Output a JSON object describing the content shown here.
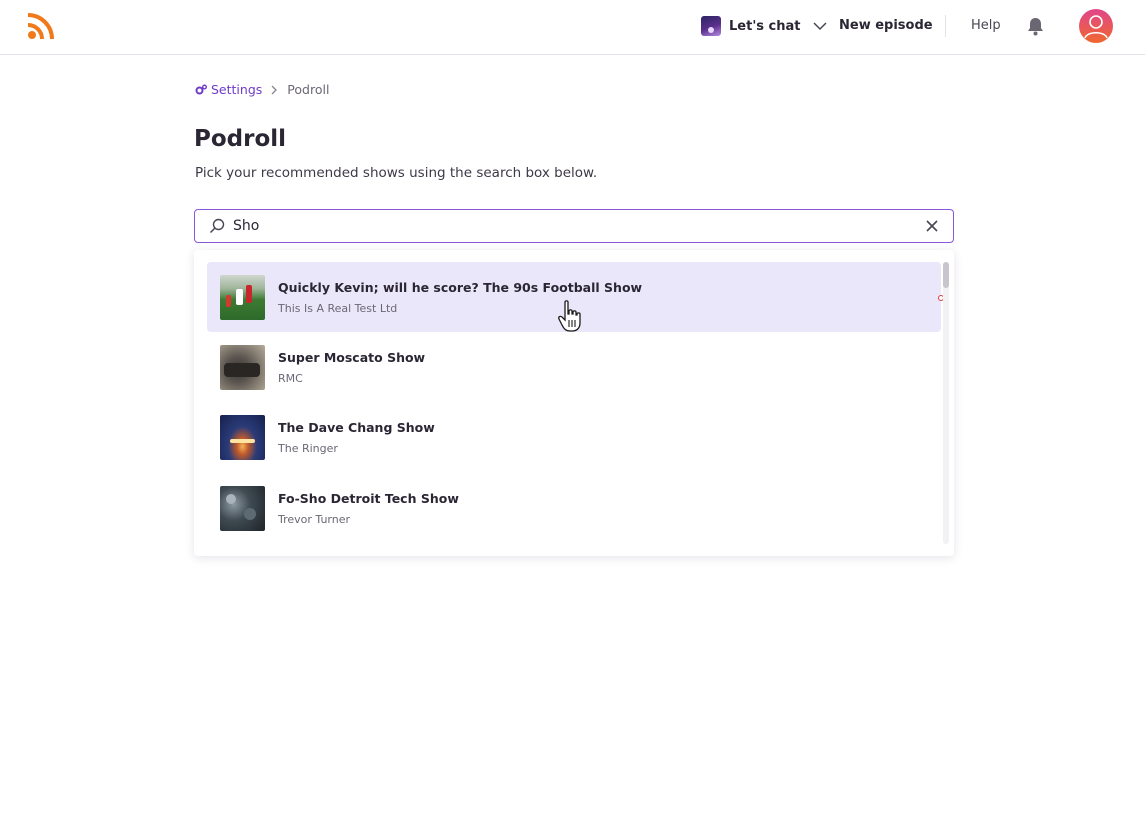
{
  "header": {
    "logo_icon": "rss-feed-icon",
    "show_name": "Let's chat",
    "new_episode_label": "New episode",
    "help_label": "Help",
    "bell_icon": "bell-icon",
    "avatar_icon": "user-avatar-icon"
  },
  "breadcrumb": {
    "settings_label": "Settings",
    "current_label": "Podroll"
  },
  "page": {
    "title": "Podroll",
    "subtitle": "Pick your recommended shows using the search box below."
  },
  "search": {
    "value": "Sho",
    "clear_icon": "close-icon"
  },
  "results": [
    {
      "title": "Quickly Kevin; will he score? The 90s Football Show",
      "author": "This Is A Real Test Ltd",
      "active": true
    },
    {
      "title": "Super Moscato Show",
      "author": "RMC",
      "active": false
    },
    {
      "title": "The Dave Chang Show",
      "author": "The Ringer",
      "active": false
    },
    {
      "title": "Fo-Sho Detroit Tech Show",
      "author": "Trevor Turner",
      "active": false
    }
  ],
  "colors": {
    "accent": "#6f3cc8",
    "search_border": "#8a57d9",
    "active_row": "#ebe7fb",
    "logo_orange": "#f07a1a",
    "avatar": "#e0468a"
  }
}
